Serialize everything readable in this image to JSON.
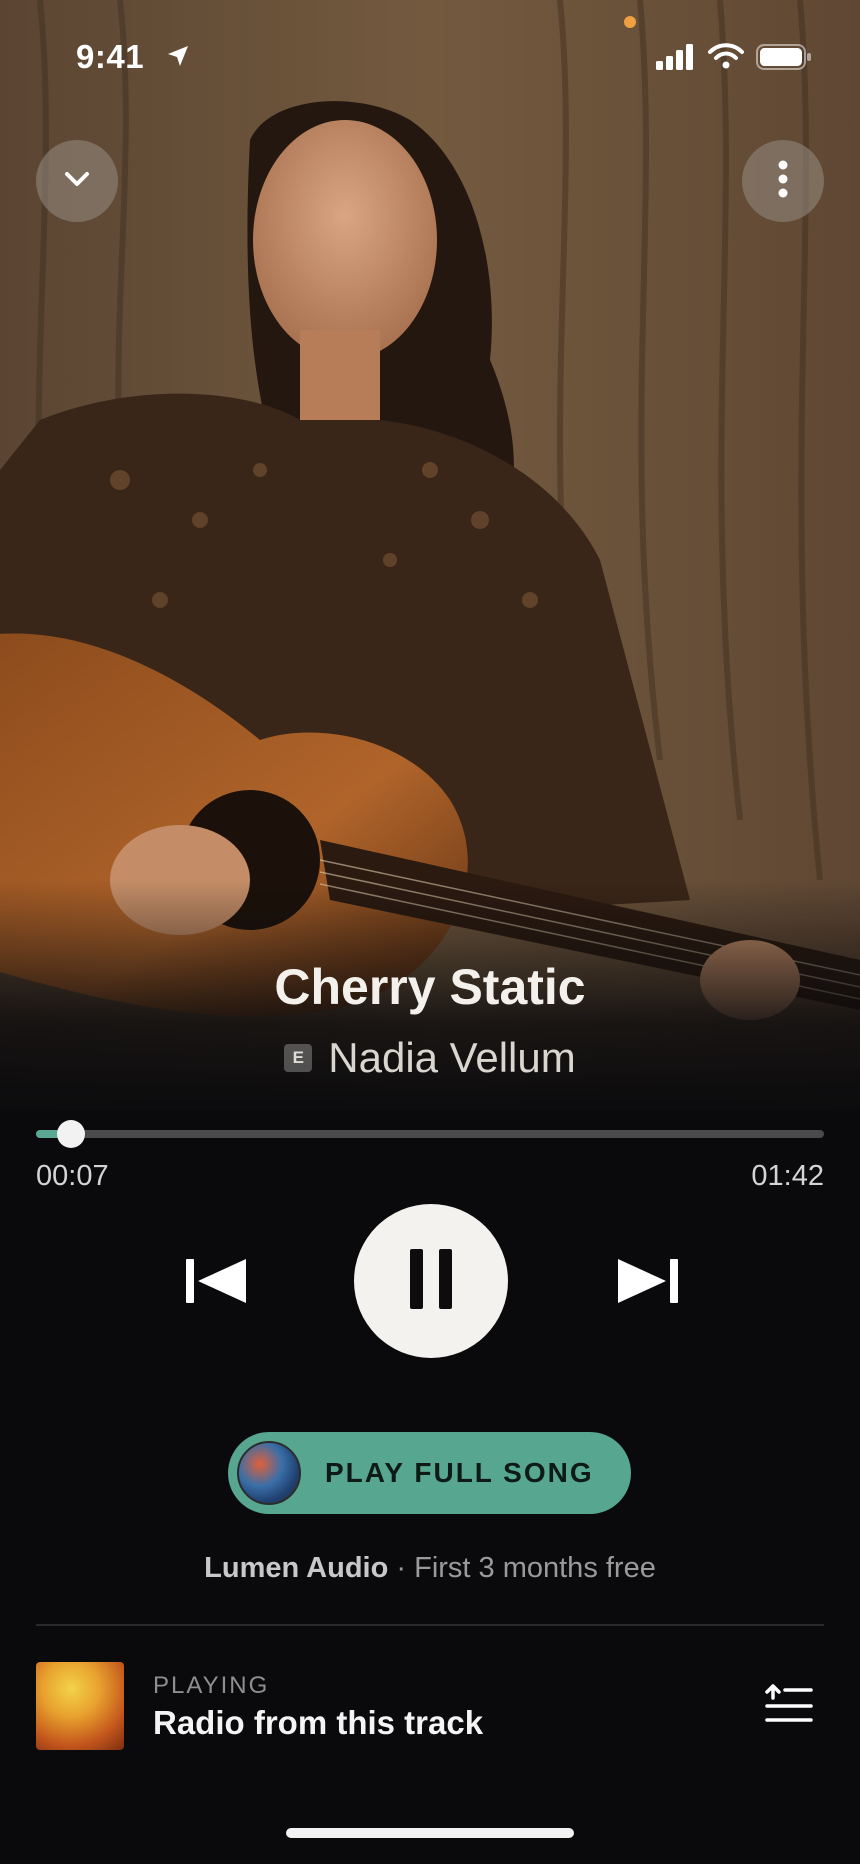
{
  "status_bar": {
    "time": "9:41"
  },
  "header": {
    "collapse_icon": "chevron-down-icon",
    "more_icon": "more-vertical-icon"
  },
  "track": {
    "title": "Cherry Static",
    "explicit_badge": "E",
    "artist": "Nadia Vellum"
  },
  "playback": {
    "elapsed": "00:07",
    "duration": "01:42",
    "progress_fraction": 0.045,
    "state": "playing"
  },
  "controls": {
    "prev_icon": "skip-previous-icon",
    "pause_icon": "pause-icon",
    "next_icon": "skip-next-icon"
  },
  "cta": {
    "label": "PLAY FULL SONG"
  },
  "promo": {
    "brand": "Lumen Audio",
    "offer": " · First 3 months free"
  },
  "radio": {
    "kicker": "PLAYING",
    "title": "Radio from this track",
    "queue_icon": "queue-icon"
  },
  "colors": {
    "accent": "#56a690",
    "progress_fill": "#5aa894",
    "background": "#0a0a0c"
  }
}
